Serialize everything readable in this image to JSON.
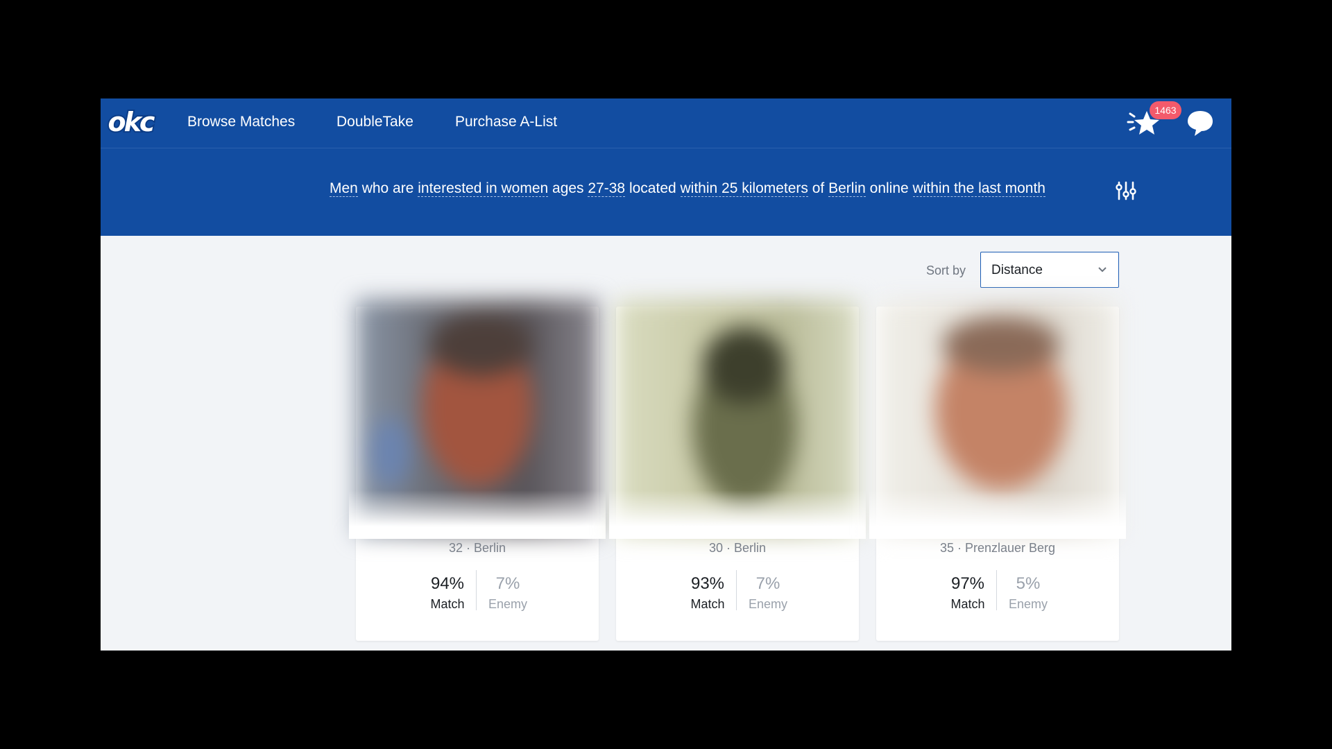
{
  "nav": {
    "logo_text": "okc",
    "links": [
      "Browse Matches",
      "DoubleTake",
      "Purchase A-List"
    ],
    "likes_count": "1463",
    "icons": {
      "likes": "star-sparkle-icon",
      "messages": "speech-bubble-icon"
    }
  },
  "filter": {
    "parts": [
      {
        "text": "Men",
        "opt": true
      },
      {
        "text": " who are ",
        "opt": false
      },
      {
        "text": "interested in women",
        "opt": true
      },
      {
        "text": " ages ",
        "opt": false
      },
      {
        "text": "27-38",
        "opt": true
      },
      {
        "text": " located ",
        "opt": false
      },
      {
        "text": "within 25 kilometers",
        "opt": true
      },
      {
        "text": " of ",
        "opt": false
      },
      {
        "text": "Berlin",
        "opt": true
      },
      {
        "text": " online ",
        "opt": false
      },
      {
        "text": "within the last month",
        "opt": true
      }
    ],
    "icon": "sliders-icon"
  },
  "sort": {
    "label": "Sort by",
    "value": "Distance"
  },
  "cards": [
    {
      "meta": "32 · Berlin",
      "match": "94%",
      "match_label": "Match",
      "enemy": "7%",
      "enemy_label": "Enemy"
    },
    {
      "meta": "30 · Berlin",
      "match": "93%",
      "match_label": "Match",
      "enemy": "7%",
      "enemy_label": "Enemy"
    },
    {
      "meta": "35 · Prenzlauer Berg",
      "match": "97%",
      "match_label": "Match",
      "enemy": "5%",
      "enemy_label": "Enemy"
    }
  ],
  "colors": {
    "brand_blue": "#124da1",
    "badge": "#f35a6b",
    "page_bg": "#f2f4f7"
  }
}
